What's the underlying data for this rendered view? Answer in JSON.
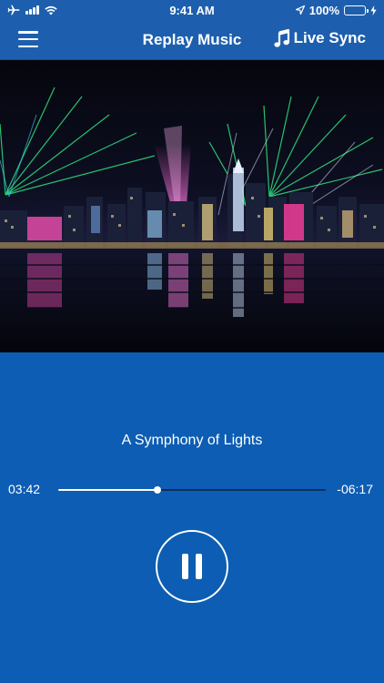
{
  "status_bar": {
    "time": "9:41 AM",
    "battery_text": "100%",
    "battery_level": 1.0,
    "icons": [
      "airplane-icon",
      "signal-icon",
      "wifi-icon",
      "location-arrow-icon",
      "battery-icon",
      "charging-bolt-icon"
    ],
    "battery_color": "#4cd964"
  },
  "nav": {
    "title": "Replay Music",
    "live_sync_label": "Live Sync",
    "menu_icon": "hamburger-menu-icon",
    "live_sync_icon": "music-note-icon"
  },
  "player": {
    "track_title": "A Symphony of Lights",
    "elapsed": "03:42",
    "remaining": "-06:17",
    "progress_fraction": 0.37,
    "control": "pause-icon"
  },
  "colors": {
    "background": "#0c5db3",
    "bar": "#1d5fae",
    "accent": "#ffffff",
    "track_rail": "#0b2f5c"
  }
}
